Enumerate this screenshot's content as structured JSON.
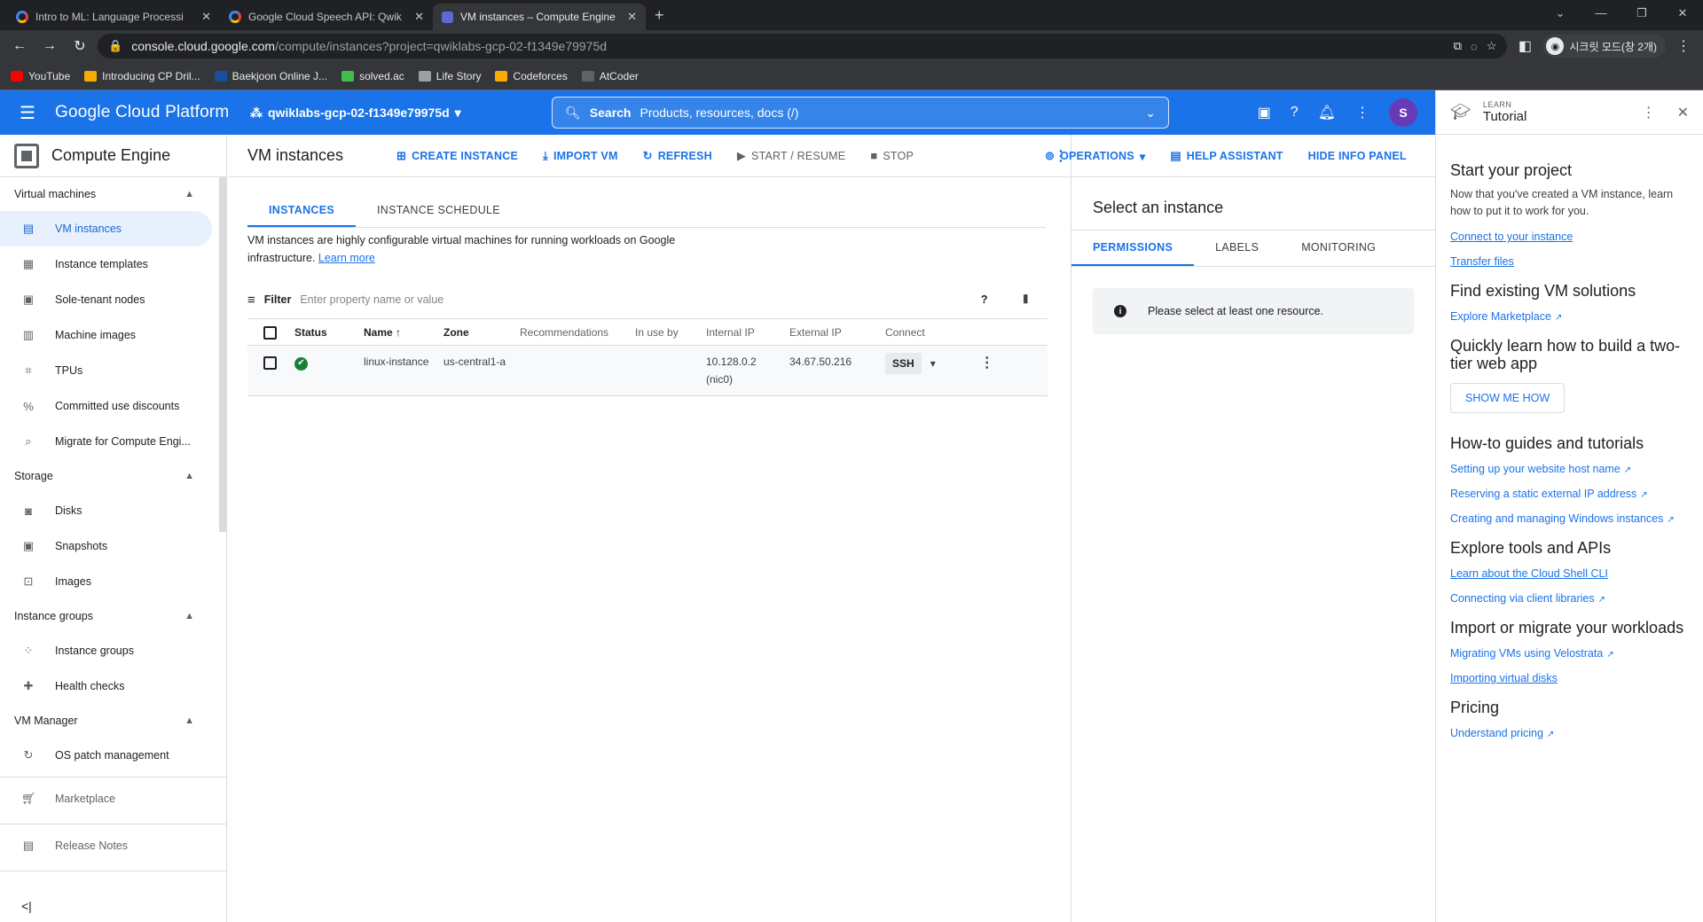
{
  "browser": {
    "tabs": [
      {
        "title": "Intro to ML: Language Processi"
      },
      {
        "title": "Google Cloud Speech API: Qwik"
      },
      {
        "title": "VM instances – Compute Engine"
      }
    ],
    "url_host": "console.cloud.google.com",
    "url_path": "/compute/instances?project=qwiklabs-gcp-02-f1349e79975d",
    "profile_label": "시크릿 모드(창 2개)",
    "bookmarks": [
      "YouTube",
      "Introducing CP Dril...",
      "Baekjoon Online J...",
      "solved.ac",
      "Life Story",
      "Codeforces",
      "AtCoder"
    ]
  },
  "header": {
    "title": "Google Cloud Platform",
    "project": "qwiklabs-gcp-02-f1349e79975d",
    "search_label": "Search",
    "search_placeholder": "Products, resources, docs (/)",
    "avatar": "S",
    "accent": "#1a73e8"
  },
  "sidebar": {
    "product": "Compute Engine",
    "sections": [
      {
        "label": "Virtual machines",
        "items": [
          "VM instances",
          "Instance templates",
          "Sole-tenant nodes",
          "Machine images",
          "TPUs",
          "Committed use discounts",
          "Migrate for Compute Engi..."
        ]
      },
      {
        "label": "Storage",
        "items": [
          "Disks",
          "Snapshots",
          "Images"
        ]
      },
      {
        "label": "Instance groups",
        "items": [
          "Instance groups",
          "Health checks"
        ]
      },
      {
        "label": "VM Manager",
        "items": [
          "OS patch management"
        ]
      }
    ],
    "extra": [
      "Marketplace",
      "Release Notes"
    ]
  },
  "toolbar": {
    "page_title": "VM instances",
    "create": "CREATE INSTANCE",
    "import": "IMPORT VM",
    "refresh": "REFRESH",
    "start": "START / RESUME",
    "stop": "STOP",
    "operations": "OPERATIONS",
    "help": "HELP ASSISTANT",
    "hide": "HIDE INFO PANEL"
  },
  "main": {
    "tabs": [
      "INSTANCES",
      "INSTANCE SCHEDULE"
    ],
    "intro": "VM instances are highly configurable virtual machines for running workloads on Google infrastructure.",
    "learn_more": "Learn more",
    "filter_label": "Filter",
    "filter_placeholder": "Enter property name or value",
    "columns": [
      "Status",
      "Name",
      "Zone",
      "Recommendations",
      "In use by",
      "Internal IP",
      "External IP",
      "Connect"
    ],
    "rows": [
      {
        "name": "linux-instance",
        "zone": "us-central1-a",
        "internal_ip": "10.128.0.2 (nic0)",
        "external_ip": "34.67.50.216",
        "connect": "SSH"
      }
    ]
  },
  "info_panel": {
    "title": "Select an instance",
    "tabs": [
      "PERMISSIONS",
      "LABELS",
      "MONITORING"
    ],
    "notice": "Please select at least one resource."
  },
  "tutorial": {
    "small": "LEARN",
    "title": "Tutorial",
    "h_start": "Start your project",
    "p_start": "Now that you've created a VM instance, learn how to put it to work for you.",
    "link_connect": "Connect to your instance",
    "link_transfer": "Transfer files",
    "h_find": "Find existing VM solutions",
    "link_marketplace": "Explore Marketplace",
    "h_quick": "Quickly learn how to build a two-tier web app",
    "show_me": "SHOW ME HOW",
    "h_howto": "How-to guides and tutorials",
    "link_host": "Setting up your website host name",
    "link_ip": "Reserving a static external IP address",
    "link_windows": "Creating and managing Windows instances",
    "h_tools": "Explore tools and APIs",
    "link_cli": "Learn about the Cloud Shell CLI",
    "link_libs": "Connecting via client libraries",
    "h_import": "Import or migrate your workloads",
    "link_velo": "Migrating VMs using Velostrata",
    "link_disks": "Importing virtual disks",
    "h_pricing": "Pricing",
    "link_pricing": "Understand pricing"
  }
}
